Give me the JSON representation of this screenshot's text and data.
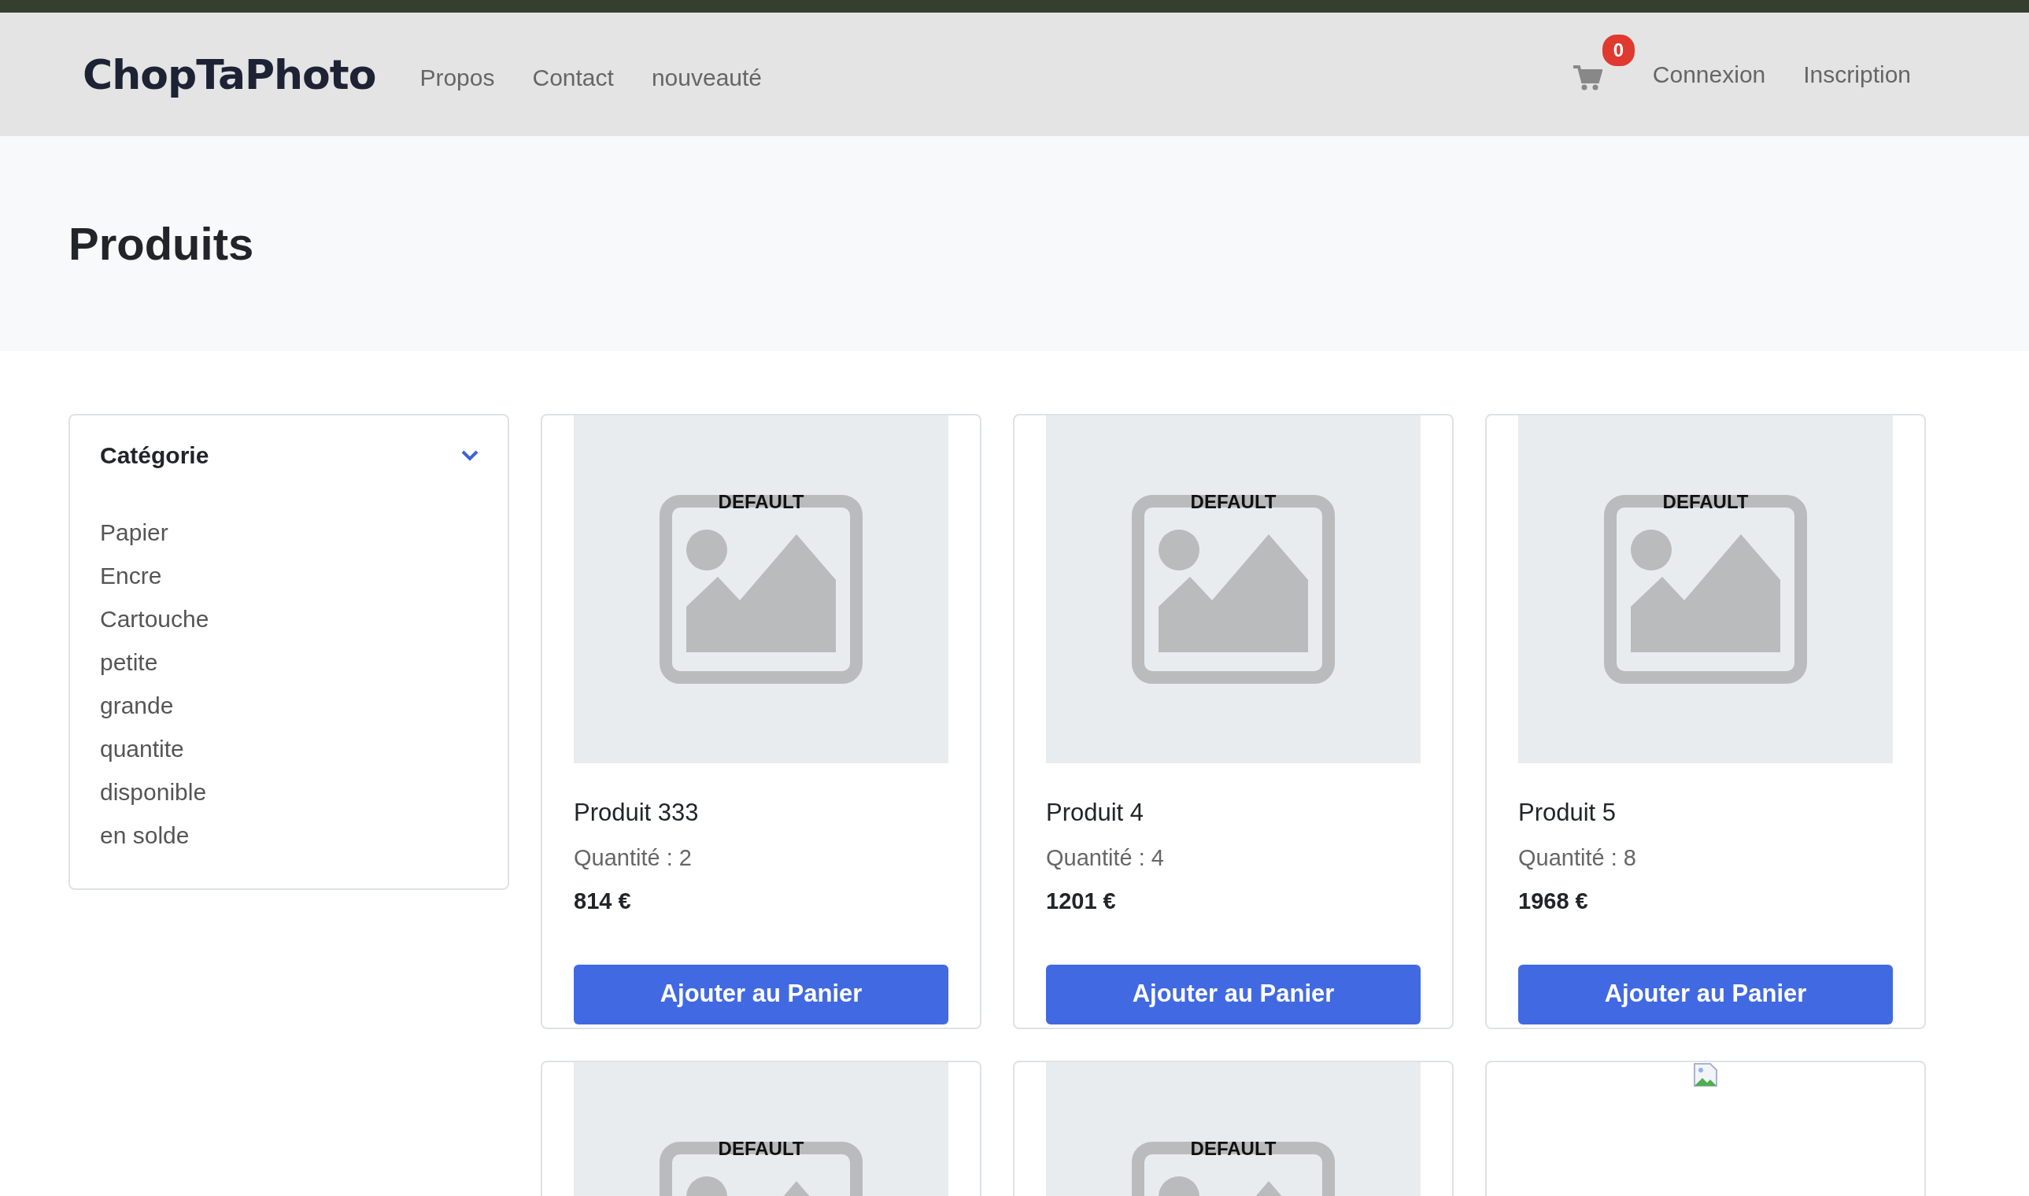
{
  "brand": "ChopTaPhoto",
  "nav_links": [
    "Propos",
    "Contact",
    "nouveauté"
  ],
  "cart": {
    "count": "0"
  },
  "auth_links": [
    "Connexion",
    "Inscription"
  ],
  "page_title": "Produits",
  "sidebar": {
    "title": "Catégorie",
    "expanded": true,
    "items": [
      "Papier",
      "Encre",
      "Cartouche",
      "petite",
      "grande",
      "quantite",
      "disponible",
      "en solde"
    ]
  },
  "products": [
    {
      "image": {
        "kind": "default",
        "label": "DEFAULT"
      },
      "name": "Produit 333",
      "quantity": "Quantité : 2",
      "price": "814 €",
      "button": "Ajouter au Panier"
    },
    {
      "image": {
        "kind": "default",
        "label": "DEFAULT"
      },
      "name": "Produit 4",
      "quantity": "Quantité : 4",
      "price": "1201 €",
      "button": "Ajouter au Panier"
    },
    {
      "image": {
        "kind": "default",
        "label": "DEFAULT"
      },
      "name": "Produit 5",
      "quantity": "Quantité : 8",
      "price": "1968 €",
      "button": "Ajouter au Panier"
    },
    {
      "image": {
        "kind": "default",
        "label": "DEFAULT"
      }
    },
    {
      "image": {
        "kind": "default",
        "label": "DEFAULT"
      }
    },
    {
      "image": {
        "kind": "broken"
      }
    }
  ]
}
